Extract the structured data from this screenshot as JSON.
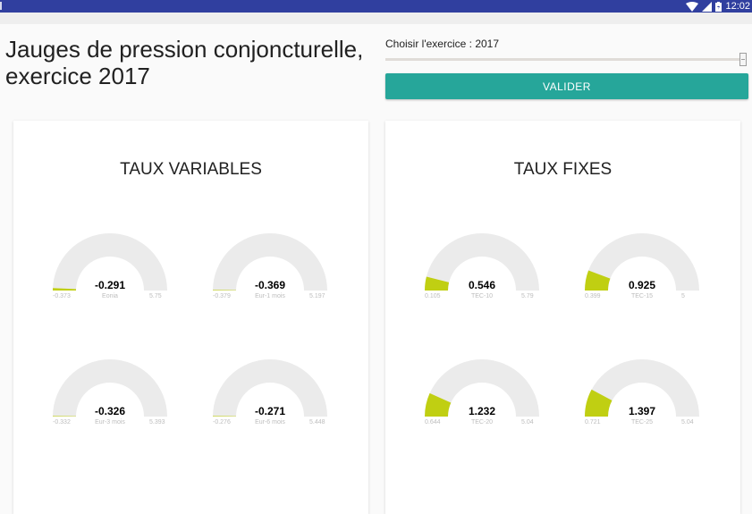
{
  "status_bar": {
    "time": "12:02"
  },
  "page_title": "Jauges de pression conjoncturelle, exercice 2017",
  "slider": {
    "label": "Choisir l'exercice : 2017",
    "value": 2017
  },
  "validate_button": {
    "label": "VALIDER"
  },
  "colors": {
    "accent": "#26a69a",
    "gauge_fill": "#c0cf12",
    "gauge_bg": "#ebebeb",
    "status_bar": "#303f9f"
  },
  "panels": [
    {
      "title": "TAUX VARIABLES",
      "gauges": [
        {
          "value": "-0.291",
          "min": "-0.373",
          "max": "5.75",
          "label": "Eonia"
        },
        {
          "value": "-0.369",
          "min": "-0.379",
          "max": "5.197",
          "label": "Eur-1 mois"
        },
        {
          "value": "-0.326",
          "min": "-0.332",
          "max": "5.393",
          "label": "Eur-3 mois"
        },
        {
          "value": "-0.271",
          "min": "-0.276",
          "max": "5.448",
          "label": "Eur-6 mois"
        }
      ]
    },
    {
      "title": "TAUX FIXES",
      "gauges": [
        {
          "value": "0.546",
          "min": "0.105",
          "max": "5.79",
          "label": "TEC-10"
        },
        {
          "value": "0.925",
          "min": "0.399",
          "max": "5",
          "label": "TEC-15"
        },
        {
          "value": "1.232",
          "min": "0.644",
          "max": "5.04",
          "label": "TEC-20"
        },
        {
          "value": "1.397",
          "min": "0.721",
          "max": "5.04",
          "label": "TEC-25"
        }
      ]
    }
  ]
}
